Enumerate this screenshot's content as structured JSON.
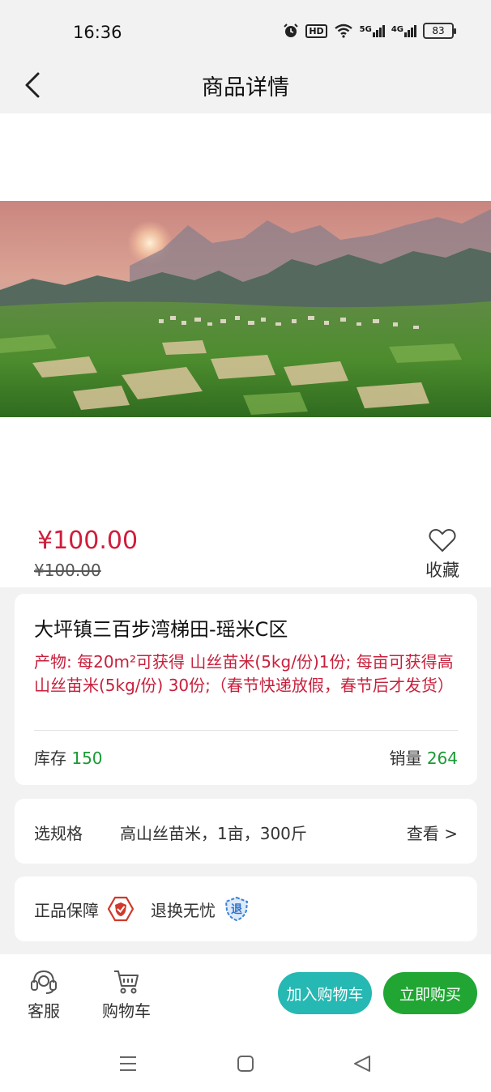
{
  "status_bar": {
    "time": "16:36",
    "hd": "HD",
    "net_5g": "5G",
    "net_4g": "4G",
    "battery": "83"
  },
  "nav": {
    "title": "商品详情"
  },
  "product": {
    "price": "¥100.00",
    "original_price": "¥100.00",
    "favorite_label": "收藏",
    "title": "大坪镇三百步湾梯田-瑶米C区",
    "description": "产物: 每20m²可获得 山丝苗米(5kg/份)1份; 每亩可获得高山丝苗米(5kg/份) 30份;（春节快递放假，春节后才发货）",
    "stock_label": "库存",
    "stock_value": "150",
    "sales_label": "销量",
    "sales_value": "264"
  },
  "spec": {
    "label": "选规格",
    "value": "高山丝苗米，1亩，300斤",
    "view": "查看 >"
  },
  "guarantee": {
    "authentic": "正品保障",
    "return": "退换无忧",
    "return_badge": "退"
  },
  "actions": {
    "service": "客服",
    "cart": "购物车",
    "add_to_cart": "加入购物车",
    "buy_now": "立即购买"
  },
  "colors": {
    "price_red": "#d01c3a",
    "green": "#1a9a33",
    "cart_button": "#26b8b2",
    "buy_button": "#21a634"
  }
}
